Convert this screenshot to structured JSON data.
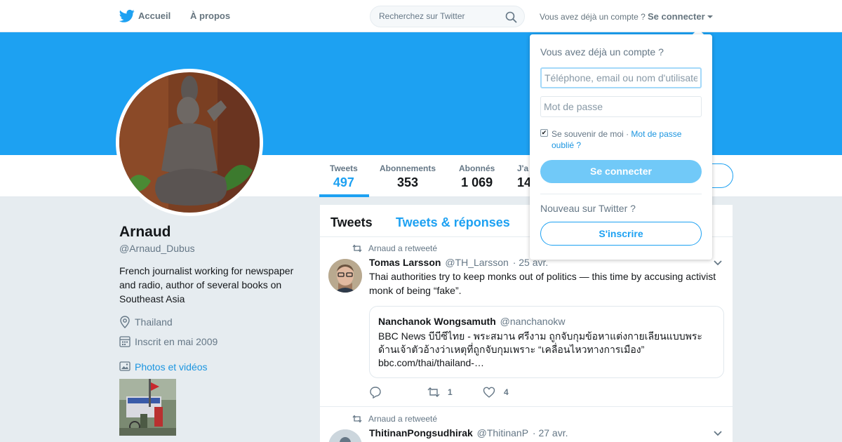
{
  "nav": {
    "home_label": "Accueil",
    "about_label": "À propos",
    "search_placeholder": "Recherchez sur Twitter",
    "login_prompt": "Vous avez déjà un compte ?",
    "login_link": "Se connecter"
  },
  "colors": {
    "accent": "#1da1f2",
    "link": "#1b95e0",
    "banner": "#1da1f2"
  },
  "profile_nav": {
    "stats": [
      {
        "label": "Tweets",
        "value": "497"
      },
      {
        "label": "Abonnements",
        "value": "353"
      },
      {
        "label": "Abonnés",
        "value": "1 069"
      },
      {
        "label": "J'a",
        "value": "14"
      }
    ]
  },
  "profile": {
    "name": "Arnaud",
    "handle": "@Arnaud_Dubus",
    "bio": "French journalist working for newspaper and radio, author of several books on Southeast Asia",
    "location": "Thailand",
    "joined": "Inscrit en mai 2009",
    "photos_link": "Photos et vidéos"
  },
  "timeline": {
    "tab_tweets": "Tweets",
    "tab_replies": "Tweets & réponses",
    "tweets": [
      {
        "retweet_label": "Arnaud a retweeté",
        "author": "Tomas Larsson",
        "handle": "@TH_Larsson",
        "date": "· 25 avr.",
        "text": "Thai authorities try to keep monks out of politics — this time by accusing activist monk of being “fake”.",
        "quote": {
          "author": "Nanchanok Wongsamuth",
          "handle": "@nanchanokw",
          "text": "BBC News บีบีซีไทย - พระสมาน ศรีงาม ถูกจับกุมข้อหาแต่งกายเลียนแบบพระด้านเจ้าตัวอ้างว่าเหตุที่ถูกจับกุมเพราะ “เคลื่อนไหวทางการเมือง” bbc.com/thai/thailand-…"
        },
        "retweets": "1",
        "likes": "4"
      },
      {
        "retweet_label": "Arnaud a retweeté",
        "author": "ThitinanPongsudhirak",
        "handle": "@ThitinanP",
        "date": "· 27 avr."
      }
    ]
  },
  "login_dropdown": {
    "title": "Vous avez déjà un compte ?",
    "username_placeholder": "Téléphone, email ou nom d'utilisateur",
    "password_placeholder": "Mot de passe",
    "remember_label": "Se souvenir de moi",
    "remember_checked": true,
    "forgot_link": "Mot de passe oublié ?",
    "login_button": "Se connecter",
    "new_prompt": "Nouveau sur Twitter ?",
    "signup_button": "S'inscrire"
  }
}
